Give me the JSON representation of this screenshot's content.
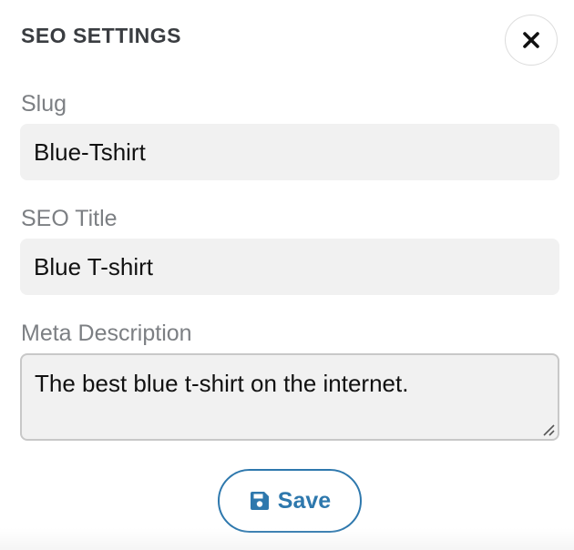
{
  "panel": {
    "title": "SEO SETTINGS",
    "close_icon": "close-icon"
  },
  "fields": {
    "slug": {
      "label": "Slug",
      "value": "Blue-Tshirt"
    },
    "seo_title": {
      "label": "SEO Title",
      "value": "Blue T-shirt"
    },
    "meta_description": {
      "label": "Meta Description",
      "value": "The best blue t-shirt on the internet."
    }
  },
  "save_button": {
    "label": "Save",
    "icon": "floppy-disk-icon"
  },
  "colors": {
    "accent": "#2e78ad",
    "title_text": "#3a3d41",
    "label_text": "#7c7f83",
    "input_background": "#f1f1f1"
  }
}
